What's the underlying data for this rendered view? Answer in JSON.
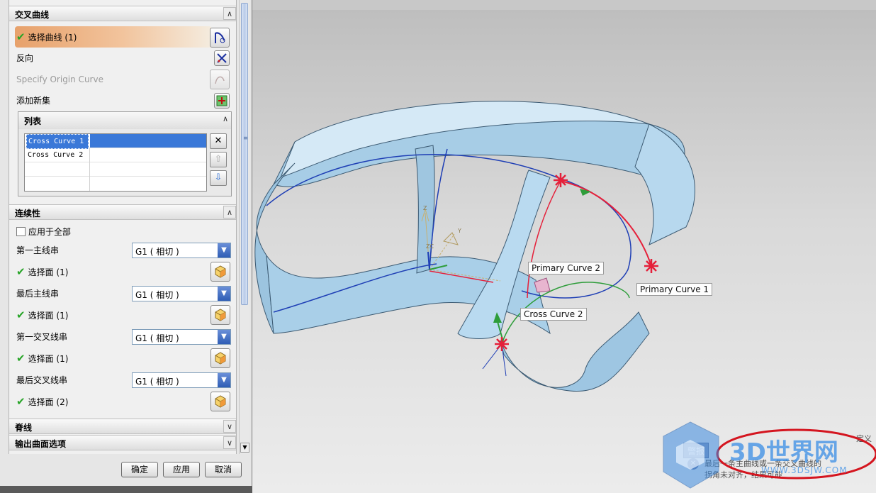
{
  "dialog": {
    "section_cross_curve": {
      "title": "交叉曲线"
    },
    "select_curve": {
      "label": "选择曲线 (1)"
    },
    "reverse": {
      "label": "反向"
    },
    "origin_curve": {
      "label": "Specify Origin Curve"
    },
    "add_new_set": {
      "label": "添加新集"
    },
    "list": {
      "title": "列表",
      "rows": [
        {
          "name": "Cross Curve  1",
          "selected": true
        },
        {
          "name": "Cross Curve  2",
          "selected": false
        }
      ]
    },
    "section_continuity": {
      "title": "连续性"
    },
    "apply_all": {
      "label": "应用于全部",
      "checked": false
    },
    "continuity_rows": [
      {
        "label": "第一主线串",
        "value": "G1 ( 相切 )",
        "face_label": "选择面 (1)"
      },
      {
        "label": "最后主线串",
        "value": "G1 ( 相切 )",
        "face_label": "选择面 (1)"
      },
      {
        "label": "第一交叉线串",
        "value": "G1 ( 相切 )",
        "face_label": "选择面 (1)"
      },
      {
        "label": "最后交叉线串",
        "value": "G1 ( 相切 )",
        "face_label": "选择面 (2)"
      }
    ],
    "section_spine": {
      "title": "脊线"
    },
    "section_output": {
      "title": "输出曲面选项"
    },
    "buttons": {
      "ok": "确定",
      "apply": "应用",
      "cancel": "取消"
    }
  },
  "viewport": {
    "tags": {
      "primary_curve_2": "Primary Curve  2",
      "primary_curve_1": "Primary Curve  1",
      "cross_curve_2": "Cross Curve  2"
    },
    "csys_labels": {
      "z": "Z",
      "zc": "ZC",
      "y": "Y"
    }
  },
  "message": {
    "badge": "警报",
    "line1": "最后一条主曲线或一条交叉曲线的",
    "line2": "拐角未对齐，结果可能",
    "edge": "定义"
  },
  "watermark": {
    "brand": "3D世界网",
    "url": "WWW.3DSJW.COM"
  },
  "colors": {
    "surface": "#a9cfe8",
    "surface_edge": "#3c5a72",
    "selection": "#e5203a",
    "accent": "#e7a16b",
    "blue_curve": "#1f3fb5",
    "green_curve": "#2e9d3a"
  }
}
